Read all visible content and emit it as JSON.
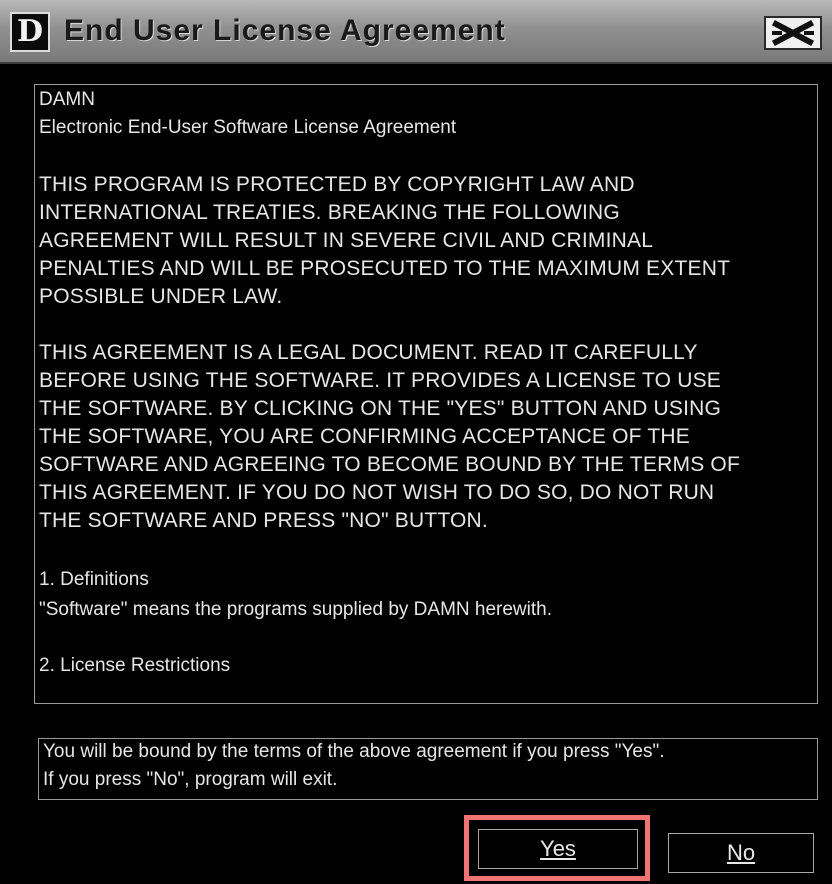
{
  "window": {
    "title": "End User License Agreement",
    "logo_letter": "D"
  },
  "license": {
    "lines": [
      "DAMN",
      "Electronic End-User Software License Agreement",
      "THIS PROGRAM IS PROTECTED BY COPYRIGHT LAW AND",
      "INTERNATIONAL TREATIES. BREAKING THE FOLLOWING",
      "AGREEMENT WILL RESULT IN SEVERE CIVIL AND CRIMINAL",
      "PENALTIES AND WILL BE PROSECUTED TO THE MAXIMUM EXTENT",
      "POSSIBLE UNDER LAW.",
      "THIS AGREEMENT IS A LEGAL DOCUMENT. READ IT CAREFULLY",
      "BEFORE USING THE SOFTWARE. IT PROVIDES A LICENSE TO USE",
      "THE SOFTWARE. BY CLICKING ON THE \"YES\" BUTTON AND USING",
      "THE SOFTWARE, YOU ARE CONFIRMING ACCEPTANCE OF THE",
      "SOFTWARE AND AGREEING TO BECOME BOUND BY THE TERMS OF",
      "THIS AGREEMENT. IF YOU DO NOT WISH TO DO SO, DO NOT RUN",
      "THE SOFTWARE AND PRESS \"NO\" BUTTON.",
      "1. Definitions",
      "\"Software\" means the programs supplied by DAMN herewith.",
      "2. License Restrictions"
    ]
  },
  "notice": {
    "line1": "You will be bound by the terms of the above agreement if you press \"Yes\".",
    "line2": "If you press \"No\", program will exit."
  },
  "buttons": {
    "yes_label": "Yes",
    "no_label": "No"
  },
  "colors": {
    "background": "#000000",
    "highlight": "#f07474",
    "text": "#e6e6e6"
  },
  "icons": {
    "close": "close-icon",
    "logo": "app-logo-icon"
  }
}
